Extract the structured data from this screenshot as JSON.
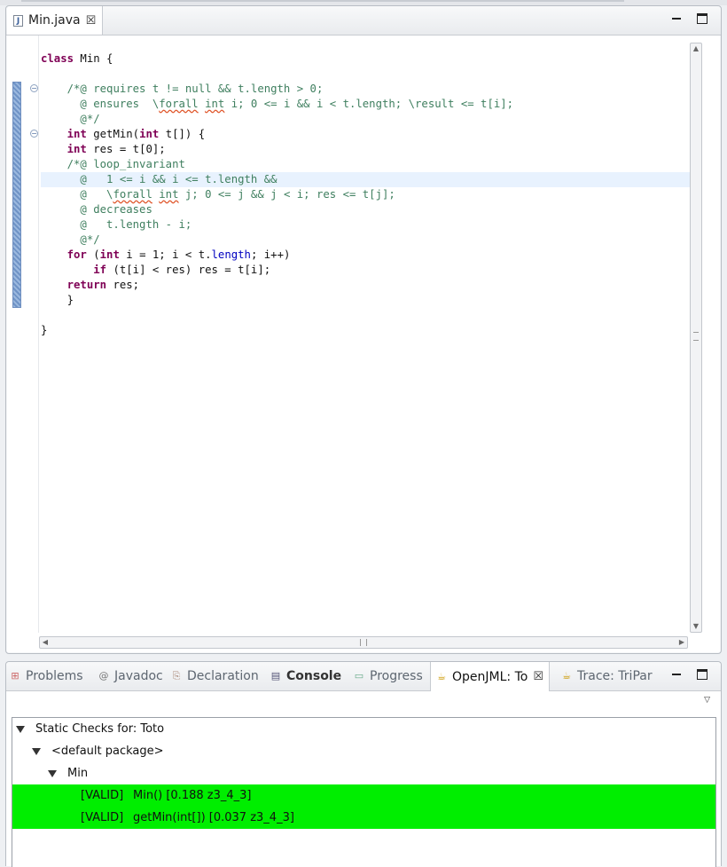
{
  "editor": {
    "tab_title": "Min.java",
    "code_lines": [
      [
        {
          "t": "class",
          "c": "kw"
        },
        {
          "t": " Min {",
          "c": ""
        }
      ],
      [
        {
          "t": "",
          "c": ""
        }
      ],
      [
        {
          "t": "    ",
          "c": ""
        },
        {
          "t": "/*@ requires t != null && t.length > 0;",
          "c": "cm"
        }
      ],
      [
        {
          "t": "      @ ensures  \\",
          "c": "cm"
        },
        {
          "t": "forall",
          "c": "cm sq"
        },
        {
          "t": " ",
          "c": "cm"
        },
        {
          "t": "int",
          "c": "cm sq"
        },
        {
          "t": " i; 0 <= i && i < t.length; \\result <= t[i];",
          "c": "cm"
        }
      ],
      [
        {
          "t": "      @*/",
          "c": "cm"
        }
      ],
      [
        {
          "t": "    ",
          "c": ""
        },
        {
          "t": "int",
          "c": "kw"
        },
        {
          "t": " getMin(",
          "c": ""
        },
        {
          "t": "int",
          "c": "kw"
        },
        {
          "t": " t[]) {",
          "c": ""
        }
      ],
      [
        {
          "t": "    ",
          "c": ""
        },
        {
          "t": "int",
          "c": "kw"
        },
        {
          "t": " res = t[0];",
          "c": ""
        }
      ],
      [
        {
          "t": "    ",
          "c": ""
        },
        {
          "t": "/*@ loop_invariant",
          "c": "cm"
        }
      ],
      [
        {
          "t": "      @   1 <= i && i <= t.length &&",
          "c": "cm"
        }
      ],
      [
        {
          "t": "      @   \\",
          "c": "cm"
        },
        {
          "t": "forall",
          "c": "cm sq"
        },
        {
          "t": " ",
          "c": "cm"
        },
        {
          "t": "int",
          "c": "cm sq"
        },
        {
          "t": " j; 0 <= j && j < i; res <= t[j];",
          "c": "cm"
        }
      ],
      [
        {
          "t": "      @ decreases",
          "c": "cm"
        }
      ],
      [
        {
          "t": "      @   t.length - i;",
          "c": "cm"
        }
      ],
      [
        {
          "t": "      @*/",
          "c": "cm"
        }
      ],
      [
        {
          "t": "    ",
          "c": ""
        },
        {
          "t": "for",
          "c": "kw"
        },
        {
          "t": " (",
          "c": ""
        },
        {
          "t": "int",
          "c": "kw"
        },
        {
          "t": " i = 1; i < t.",
          "c": ""
        },
        {
          "t": "length",
          "c": "fld"
        },
        {
          "t": "; i++)",
          "c": ""
        }
      ],
      [
        {
          "t": "        ",
          "c": ""
        },
        {
          "t": "if",
          "c": "kw"
        },
        {
          "t": " (t[i] < res) res = t[i];",
          "c": ""
        }
      ],
      [
        {
          "t": "    ",
          "c": ""
        },
        {
          "t": "return",
          "c": "kw"
        },
        {
          "t": " res;",
          "c": ""
        }
      ],
      [
        {
          "t": "    }",
          "c": ""
        }
      ],
      [
        {
          "t": "",
          "c": ""
        }
      ],
      [
        {
          "t": "}",
          "c": ""
        }
      ]
    ],
    "highlighted_line": 8
  },
  "bottom": {
    "tabs": [
      {
        "label": "Problems",
        "icon": "problems-icon"
      },
      {
        "label": "Javadoc",
        "icon": "at-icon"
      },
      {
        "label": "Declaration",
        "icon": "declaration-icon"
      },
      {
        "label": "Console",
        "icon": "console-icon"
      },
      {
        "label": "Progress",
        "icon": "progress-icon"
      },
      {
        "label": "OpenJML: To",
        "icon": "openjml-icon"
      },
      {
        "label": "Trace: TriPar",
        "icon": "trace-icon"
      }
    ],
    "tree": {
      "root": "Static Checks for: Toto",
      "package": "<default package>",
      "class": "Min",
      "results": [
        {
          "status": "[VALID]",
          "item": "Min() [0.188 z3_4_3]"
        },
        {
          "status": "[VALID]",
          "item": "getMin(int[]) [0.037 z3_4_3]"
        }
      ]
    }
  },
  "colors": {
    "valid": "#00ee00",
    "keyword": "#7f0055",
    "comment": "#3f7f5f",
    "field": "#0000c0"
  }
}
